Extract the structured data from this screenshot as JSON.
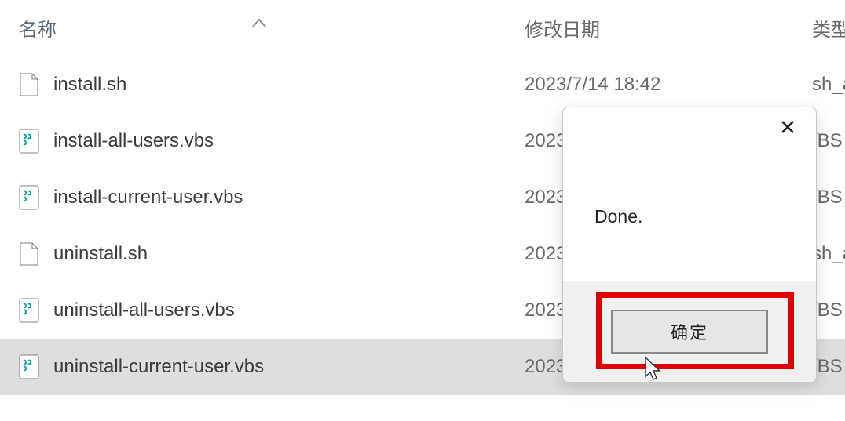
{
  "columns": {
    "name": "名称",
    "date": "修改日期",
    "type": "类型"
  },
  "files": [
    {
      "name": "install.sh",
      "date": "2023/7/14 18:42",
      "type": "sh_a",
      "icon": "doc"
    },
    {
      "name": "install-all-users.vbs",
      "date": "2023",
      "type": "/BS",
      "icon": "vbs"
    },
    {
      "name": "install-current-user.vbs",
      "date": "2023",
      "type": "/BS",
      "icon": "vbs"
    },
    {
      "name": "uninstall.sh",
      "date": "2023",
      "type": "sh_a",
      "icon": "doc"
    },
    {
      "name": "uninstall-all-users.vbs",
      "date": "2023",
      "type": "/BS",
      "icon": "vbs"
    },
    {
      "name": "uninstall-current-user.vbs",
      "date": "2023,",
      "type": "/BS",
      "icon": "vbs"
    }
  ],
  "dialog": {
    "message": "Done.",
    "ok": "确定"
  }
}
